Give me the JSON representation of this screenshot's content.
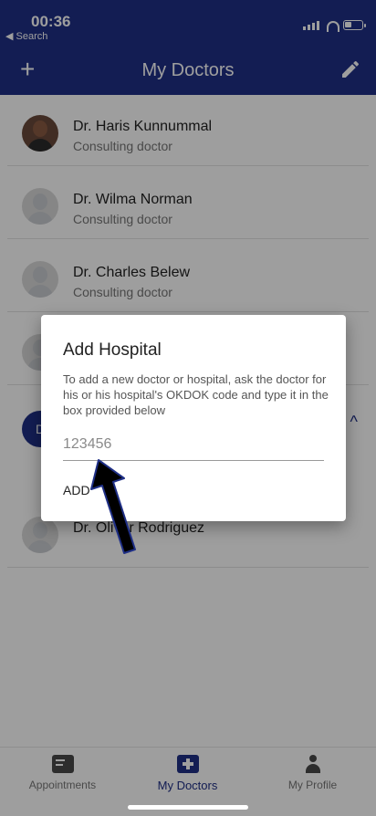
{
  "status": {
    "time": "00:36",
    "back": "◀ Search"
  },
  "header": {
    "add_icon": "+",
    "title": "My Doctors",
    "edit_icon": "pencil-icon"
  },
  "doctors": [
    {
      "name": "Dr. Haris Kunnummal",
      "role": "Consulting doctor",
      "avatar": "photo"
    },
    {
      "name": "Dr. Wilma Norman",
      "role": "Consulting doctor",
      "avatar": "placeholder"
    },
    {
      "name": "Dr. Charles  Belew",
      "role": "Consulting doctor",
      "avatar": "placeholder"
    },
    {
      "name": "",
      "role": "",
      "avatar": "placeholder"
    },
    {
      "name": "Dr. Oliver Rodriguez",
      "role": "",
      "avatar": "placeholder"
    }
  ],
  "section": {
    "badge": "D"
  },
  "dialog": {
    "title": "Add Hospital",
    "message": "To add a new doctor or hospital, ask the doctor for his or his hospital's OKDOK code and type it in the box provided below",
    "input_placeholder": "123456",
    "add_label": "ADD"
  },
  "bottom_nav": {
    "tabs": [
      {
        "label": "Appointments",
        "icon": "appointments-icon"
      },
      {
        "label": "My Doctors",
        "icon": "doctors-icon"
      },
      {
        "label": "My Profile",
        "icon": "profile-icon"
      }
    ]
  },
  "colors": {
    "primary": "#1f2f86",
    "overlay": "rgba(0,0,0,0.38)"
  }
}
